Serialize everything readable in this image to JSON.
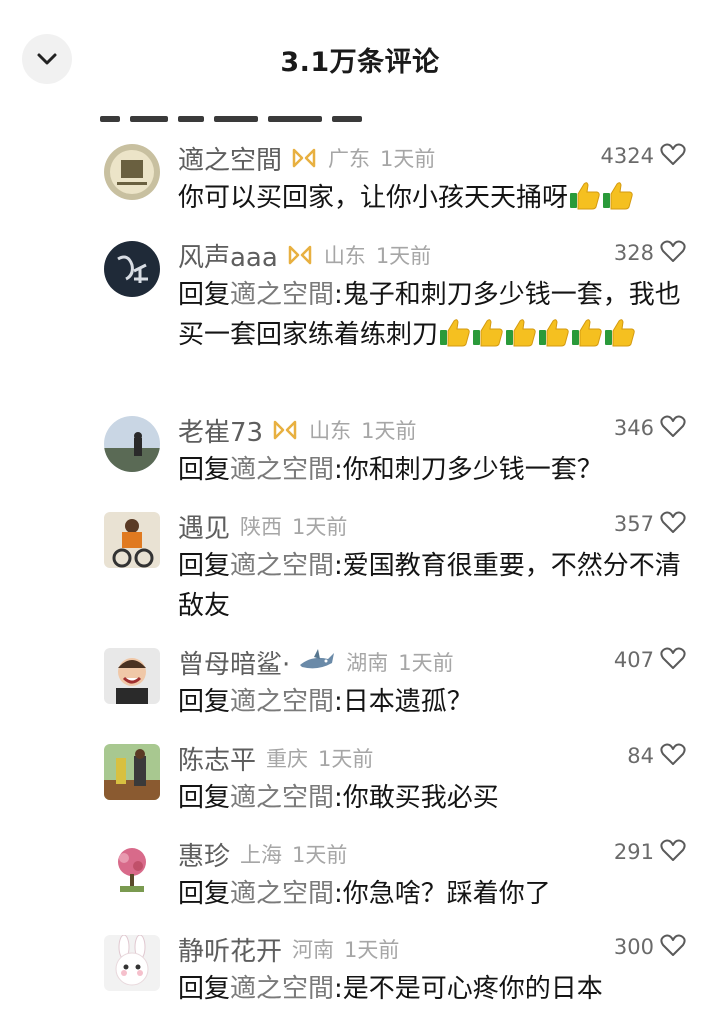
{
  "header": {
    "title": "3.1万条评论",
    "back_icon": "chevron-down-icon"
  },
  "reply_prefix": "回复",
  "mention_name": "適之空間",
  "comments": [
    {
      "name": "適之空間",
      "location": "广东",
      "time": "1天前",
      "likes": "4324",
      "badge": true,
      "text": "你可以买回家，让你小孩天天捅呀",
      "emoji": [
        "thumbs-up",
        "thumbs-up"
      ]
    },
    {
      "name": "风声aaa",
      "location": "山东",
      "time": "1天前",
      "likes": "328",
      "badge": true,
      "reply": ":鬼子和刺刀多少钱一套，我也买一套回家练着练刺刀",
      "emoji": [
        "thumbs-up",
        "thumbs-up",
        "thumbs-up",
        "thumbs-up",
        "thumbs-up",
        "thumbs-up"
      ]
    },
    {
      "name": "老崔73",
      "location": "山东",
      "time": "1天前",
      "likes": "346",
      "badge": true,
      "reply": ":你和刺刀多少钱一套？"
    },
    {
      "name": "遇见",
      "location": "陕西",
      "time": "1天前",
      "likes": "357",
      "reply": ":爱国教育很重要，不然分不清敌友"
    },
    {
      "name": "曾母暗鲨·",
      "location": "湖南",
      "time": "1天前",
      "likes": "407",
      "shark": true,
      "reply": ":日本遗孤？"
    },
    {
      "name": "陈志平",
      "location": "重庆",
      "time": "1天前",
      "likes": "84",
      "reply": ":你敢买我必买"
    },
    {
      "name": "惠珍",
      "location": "上海",
      "time": "1天前",
      "likes": "291",
      "reply": ":你急啥？踩着你了"
    },
    {
      "name": "静听花开",
      "location": "河南",
      "time": "1天前",
      "likes": "300",
      "reply": ":是不是可心疼你的日本"
    }
  ]
}
